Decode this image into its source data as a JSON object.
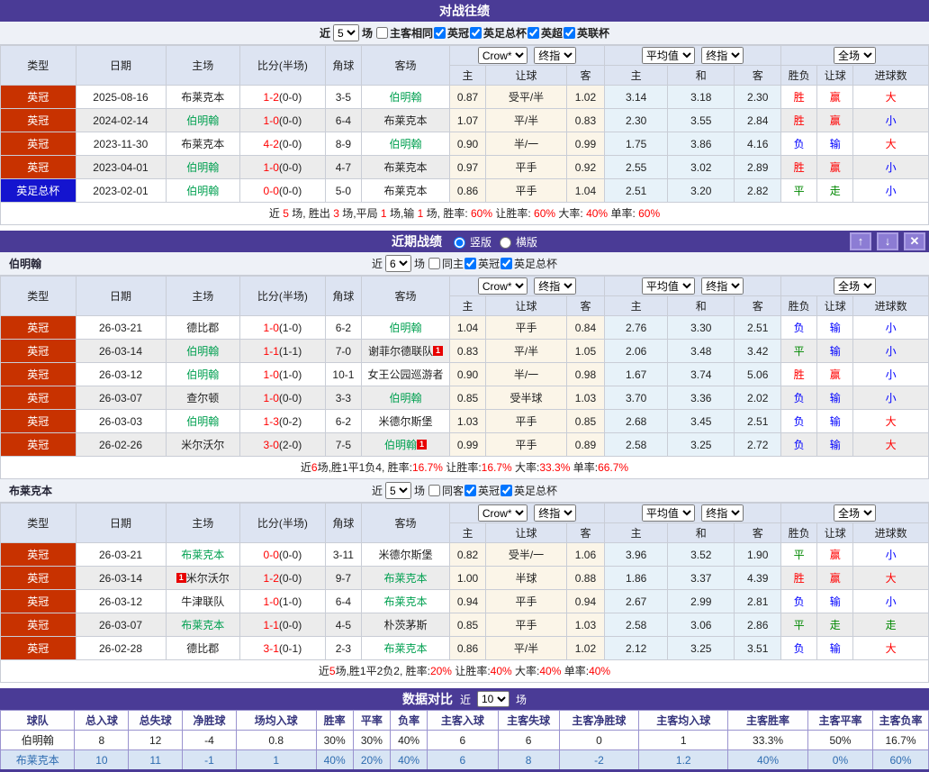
{
  "colors": {
    "accent_purple": "#4a3b96",
    "button_purple": "#8c7cd4",
    "league_red": "#c83200",
    "league_blue": "#1414cf",
    "team_green": "#00a050",
    "win_red": "#ff0000",
    "lose_blue": "#0000ff",
    "draw_green": "#008800",
    "odds_bg": "#fbf5e8",
    "avg_bg": "#e7f2f9",
    "compare_row2_bg": "#d8e5f4"
  },
  "icons": {
    "up": "↑",
    "down": "↓",
    "close": "✕"
  },
  "th": {
    "type": "类型",
    "date": "日期",
    "home": "主场",
    "score": "比分(半场)",
    "corner": "角球",
    "away": "客场",
    "h": "主",
    "hcap": "让球",
    "a": "客",
    "ah": "主",
    "ad": "和",
    "aa": "客",
    "wdl": "胜负",
    "let": "让球",
    "goals": "进球数",
    "crow": "Crow*",
    "fin": "终指",
    "avg": "平均值",
    "full": "全场"
  },
  "h2h": {
    "title": "对战往绩",
    "filter": {
      "near": "近",
      "count": "5",
      "games": "场",
      "checks": [
        {
          "label": "主客相同",
          "checked": false
        },
        {
          "label": "英冠",
          "checked": true
        },
        {
          "label": "英足总杯",
          "checked": true
        },
        {
          "label": "英超",
          "checked": true
        },
        {
          "label": "英联杯",
          "checked": true
        }
      ]
    },
    "rows": [
      {
        "lg": "英冠",
        "lgc": "red",
        "date": "2025-08-16",
        "home": {
          "n": "布莱克本"
        },
        "score": "1-2",
        "half": "(0-0)",
        "corner": "3-5",
        "away": {
          "n": "伯明翰",
          "g": 1
        },
        "odds": [
          "0.87",
          "受平/半",
          "1.02"
        ],
        "avg": [
          "3.14",
          "3.18",
          "2.30"
        ],
        "res": [
          [
            "胜",
            "r"
          ],
          [
            "赢",
            "r"
          ],
          [
            "大",
            "r"
          ]
        ]
      },
      {
        "lg": "英冠",
        "lgc": "red",
        "date": "2024-02-14",
        "home": {
          "n": "伯明翰",
          "g": 1
        },
        "score": "1-0",
        "half": "(0-0)",
        "corner": "6-4",
        "away": {
          "n": "布莱克本"
        },
        "odds": [
          "1.07",
          "平/半",
          "0.83"
        ],
        "avg": [
          "2.30",
          "3.55",
          "2.84"
        ],
        "res": [
          [
            "胜",
            "r"
          ],
          [
            "赢",
            "r"
          ],
          [
            "小",
            "b"
          ]
        ]
      },
      {
        "lg": "英冠",
        "lgc": "red",
        "date": "2023-11-30",
        "home": {
          "n": "布莱克本"
        },
        "score": "4-2",
        "half": "(0-0)",
        "corner": "8-9",
        "away": {
          "n": "伯明翰",
          "g": 1
        },
        "odds": [
          "0.90",
          "半/一",
          "0.99"
        ],
        "avg": [
          "1.75",
          "3.86",
          "4.16"
        ],
        "res": [
          [
            "负",
            "b"
          ],
          [
            "输",
            "b"
          ],
          [
            "大",
            "r"
          ]
        ]
      },
      {
        "lg": "英冠",
        "lgc": "red",
        "date": "2023-04-01",
        "home": {
          "n": "伯明翰",
          "g": 1
        },
        "score": "1-0",
        "half": "(0-0)",
        "corner": "4-7",
        "away": {
          "n": "布莱克本"
        },
        "odds": [
          "0.97",
          "平手",
          "0.92"
        ],
        "avg": [
          "2.55",
          "3.02",
          "2.89"
        ],
        "res": [
          [
            "胜",
            "r"
          ],
          [
            "赢",
            "r"
          ],
          [
            "小",
            "b"
          ]
        ]
      },
      {
        "lg": "英足总杯",
        "lgc": "blue",
        "date": "2023-02-01",
        "home": {
          "n": "伯明翰",
          "g": 1
        },
        "score": "0-0",
        "half": "(0-0)",
        "corner": "5-0",
        "away": {
          "n": "布莱克本"
        },
        "odds": [
          "0.86",
          "平手",
          "1.04"
        ],
        "avg": [
          "2.51",
          "3.20",
          "2.82"
        ],
        "res": [
          [
            "平",
            "g"
          ],
          [
            "走",
            "g"
          ],
          [
            "小",
            "b"
          ]
        ]
      }
    ],
    "summary": [
      {
        "t": "近 "
      },
      {
        "t": "5",
        "r": 1
      },
      {
        "t": " 场, 胜出 "
      },
      {
        "t": "3",
        "r": 1
      },
      {
        "t": " 场,平局 "
      },
      {
        "t": "1",
        "r": 1
      },
      {
        "t": " 场,输 "
      },
      {
        "t": "1",
        "r": 1
      },
      {
        "t": " 场, 胜率: "
      },
      {
        "t": "60%",
        "r": 1
      },
      {
        "t": " 让胜率: "
      },
      {
        "t": "60%",
        "r": 1
      },
      {
        "t": " 大率: "
      },
      {
        "t": "40%",
        "r": 1
      },
      {
        "t": " 单率: "
      },
      {
        "t": "60%",
        "r": 1
      }
    ]
  },
  "recent": {
    "title": "近期战绩",
    "layout_vertical": "竖版",
    "layout_horizontal": "横版"
  },
  "birmingham": {
    "team": "伯明翰",
    "filter": {
      "near": "近",
      "count": "6",
      "games": "场",
      "checks": [
        {
          "label": "同主",
          "checked": false
        },
        {
          "label": "英冠",
          "checked": true
        },
        {
          "label": "英足总杯",
          "checked": true
        }
      ]
    },
    "rows": [
      {
        "lg": "英冠",
        "lgc": "red",
        "date": "26-03-21",
        "home": {
          "n": "德比郡"
        },
        "score": "1-0",
        "half": "(1-0)",
        "corner": "6-2",
        "away": {
          "n": "伯明翰",
          "g": 1
        },
        "odds": [
          "1.04",
          "平手",
          "0.84"
        ],
        "avg": [
          "2.76",
          "3.30",
          "2.51"
        ],
        "res": [
          [
            "负",
            "b"
          ],
          [
            "输",
            "b"
          ],
          [
            "小",
            "b"
          ]
        ]
      },
      {
        "lg": "英冠",
        "lgc": "red",
        "date": "26-03-14",
        "home": {
          "n": "伯明翰",
          "g": 1
        },
        "score": "1-1",
        "half": "(1-1)",
        "corner": "7-0",
        "away": {
          "n": "谢菲尔德联队",
          "b": "1",
          "bp": "after"
        },
        "odds": [
          "0.83",
          "平/半",
          "1.05"
        ],
        "avg": [
          "2.06",
          "3.48",
          "3.42"
        ],
        "res": [
          [
            "平",
            "g"
          ],
          [
            "输",
            "b"
          ],
          [
            "小",
            "b"
          ]
        ]
      },
      {
        "lg": "英冠",
        "lgc": "red",
        "date": "26-03-12",
        "home": {
          "n": "伯明翰",
          "g": 1
        },
        "score": "1-0",
        "half": "(1-0)",
        "corner": "10-1",
        "away": {
          "n": "女王公园巡游者"
        },
        "odds": [
          "0.90",
          "半/一",
          "0.98"
        ],
        "avg": [
          "1.67",
          "3.74",
          "5.06"
        ],
        "res": [
          [
            "胜",
            "r"
          ],
          [
            "赢",
            "r"
          ],
          [
            "小",
            "b"
          ]
        ]
      },
      {
        "lg": "英冠",
        "lgc": "red",
        "date": "26-03-07",
        "home": {
          "n": "查尔顿"
        },
        "score": "1-0",
        "half": "(0-0)",
        "corner": "3-3",
        "away": {
          "n": "伯明翰",
          "g": 1
        },
        "odds": [
          "0.85",
          "受半球",
          "1.03"
        ],
        "avg": [
          "3.70",
          "3.36",
          "2.02"
        ],
        "res": [
          [
            "负",
            "b"
          ],
          [
            "输",
            "b"
          ],
          [
            "小",
            "b"
          ]
        ]
      },
      {
        "lg": "英冠",
        "lgc": "red",
        "date": "26-03-03",
        "home": {
          "n": "伯明翰",
          "g": 1
        },
        "score": "1-3",
        "half": "(0-2)",
        "corner": "6-2",
        "away": {
          "n": "米德尔斯堡"
        },
        "odds": [
          "1.03",
          "平手",
          "0.85"
        ],
        "avg": [
          "2.68",
          "3.45",
          "2.51"
        ],
        "res": [
          [
            "负",
            "b"
          ],
          [
            "输",
            "b"
          ],
          [
            "大",
            "r"
          ]
        ]
      },
      {
        "lg": "英冠",
        "lgc": "red",
        "date": "26-02-26",
        "home": {
          "n": "米尔沃尔"
        },
        "score": "3-0",
        "half": "(2-0)",
        "corner": "7-5",
        "away": {
          "n": "伯明翰",
          "g": 1,
          "b": "1",
          "bp": "after"
        },
        "odds": [
          "0.99",
          "平手",
          "0.89"
        ],
        "avg": [
          "2.58",
          "3.25",
          "2.72"
        ],
        "res": [
          [
            "负",
            "b"
          ],
          [
            "输",
            "b"
          ],
          [
            "大",
            "r"
          ]
        ]
      }
    ],
    "summary": [
      {
        "t": "近"
      },
      {
        "t": "6",
        "r": 1
      },
      {
        "t": "场,胜1平1负4, 胜率:"
      },
      {
        "t": "16.7%",
        "r": 1
      },
      {
        "t": " 让胜率:"
      },
      {
        "t": "16.7%",
        "r": 1
      },
      {
        "t": " 大率:"
      },
      {
        "t": "33.3%",
        "r": 1
      },
      {
        "t": " 单率:"
      },
      {
        "t": "66.7%",
        "r": 1
      }
    ]
  },
  "blackburn": {
    "team": "布莱克本",
    "filter": {
      "near": "近",
      "count": "5",
      "games": "场",
      "checks": [
        {
          "label": "同客",
          "checked": false
        },
        {
          "label": "英冠",
          "checked": true
        },
        {
          "label": "英足总杯",
          "checked": true
        }
      ]
    },
    "rows": [
      {
        "lg": "英冠",
        "lgc": "red",
        "date": "26-03-21",
        "home": {
          "n": "布莱克本",
          "g": 1
        },
        "score": "0-0",
        "half": "(0-0)",
        "corner": "3-11",
        "away": {
          "n": "米德尔斯堡"
        },
        "odds": [
          "0.82",
          "受半/一",
          "1.06"
        ],
        "avg": [
          "3.96",
          "3.52",
          "1.90"
        ],
        "res": [
          [
            "平",
            "g"
          ],
          [
            "赢",
            "r"
          ],
          [
            "小",
            "b"
          ]
        ]
      },
      {
        "lg": "英冠",
        "lgc": "red",
        "date": "26-03-14",
        "home": {
          "n": "米尔沃尔",
          "b": "1",
          "bp": "before"
        },
        "score": "1-2",
        "half": "(0-0)",
        "corner": "9-7",
        "away": {
          "n": "布莱克本",
          "g": 1
        },
        "odds": [
          "1.00",
          "半球",
          "0.88"
        ],
        "avg": [
          "1.86",
          "3.37",
          "4.39"
        ],
        "res": [
          [
            "胜",
            "r"
          ],
          [
            "赢",
            "r"
          ],
          [
            "大",
            "r"
          ]
        ]
      },
      {
        "lg": "英冠",
        "lgc": "red",
        "date": "26-03-12",
        "home": {
          "n": "牛津联队"
        },
        "score": "1-0",
        "half": "(1-0)",
        "corner": "6-4",
        "away": {
          "n": "布莱克本",
          "g": 1
        },
        "odds": [
          "0.94",
          "平手",
          "0.94"
        ],
        "avg": [
          "2.67",
          "2.99",
          "2.81"
        ],
        "res": [
          [
            "负",
            "b"
          ],
          [
            "输",
            "b"
          ],
          [
            "小",
            "b"
          ]
        ]
      },
      {
        "lg": "英冠",
        "lgc": "red",
        "date": "26-03-07",
        "home": {
          "n": "布莱克本",
          "g": 1
        },
        "score": "1-1",
        "half": "(0-0)",
        "corner": "4-5",
        "away": {
          "n": "朴茨茅斯"
        },
        "odds": [
          "0.85",
          "平手",
          "1.03"
        ],
        "avg": [
          "2.58",
          "3.06",
          "2.86"
        ],
        "res": [
          [
            "平",
            "g"
          ],
          [
            "走",
            "g"
          ],
          [
            "走",
            "g"
          ]
        ]
      },
      {
        "lg": "英冠",
        "lgc": "red",
        "date": "26-02-28",
        "home": {
          "n": "德比郡"
        },
        "score": "3-1",
        "half": "(0-1)",
        "corner": "2-3",
        "away": {
          "n": "布莱克本",
          "g": 1
        },
        "odds": [
          "0.86",
          "平/半",
          "1.02"
        ],
        "avg": [
          "2.12",
          "3.25",
          "3.51"
        ],
        "res": [
          [
            "负",
            "b"
          ],
          [
            "输",
            "b"
          ],
          [
            "大",
            "r"
          ]
        ]
      }
    ],
    "summary": [
      {
        "t": "近"
      },
      {
        "t": "5",
        "r": 1
      },
      {
        "t": "场,胜1平2负2, 胜率:"
      },
      {
        "t": "20%",
        "r": 1
      },
      {
        "t": " 让胜率:"
      },
      {
        "t": "40%",
        "r": 1
      },
      {
        "t": " 大率:"
      },
      {
        "t": "40%",
        "r": 1
      },
      {
        "t": " 单率:"
      },
      {
        "t": "40%",
        "r": 1
      }
    ]
  },
  "compare": {
    "title": "数据对比",
    "near": "近",
    "count": "10",
    "games": "场",
    "headers": [
      "球队",
      "总入球",
      "总失球",
      "净胜球",
      "场均入球",
      "胜率",
      "平率",
      "负率",
      "主客入球",
      "主客失球",
      "主客净胜球",
      "主客均入球",
      "主客胜率",
      "主客平率",
      "主客负率"
    ],
    "rows": [
      {
        "team": "伯明翰",
        "style": "dark",
        "values": [
          "8",
          "12",
          "-4",
          "0.8",
          "30%",
          "30%",
          "40%",
          "6",
          "6",
          "0",
          "1",
          "33.3%",
          "50%",
          "16.7%"
        ]
      },
      {
        "team": "布莱克本",
        "style": "blue",
        "values": [
          "10",
          "11",
          "-1",
          "1",
          "40%",
          "20%",
          "40%",
          "6",
          "8",
          "-2",
          "1.2",
          "40%",
          "0%",
          "60%"
        ]
      }
    ]
  }
}
